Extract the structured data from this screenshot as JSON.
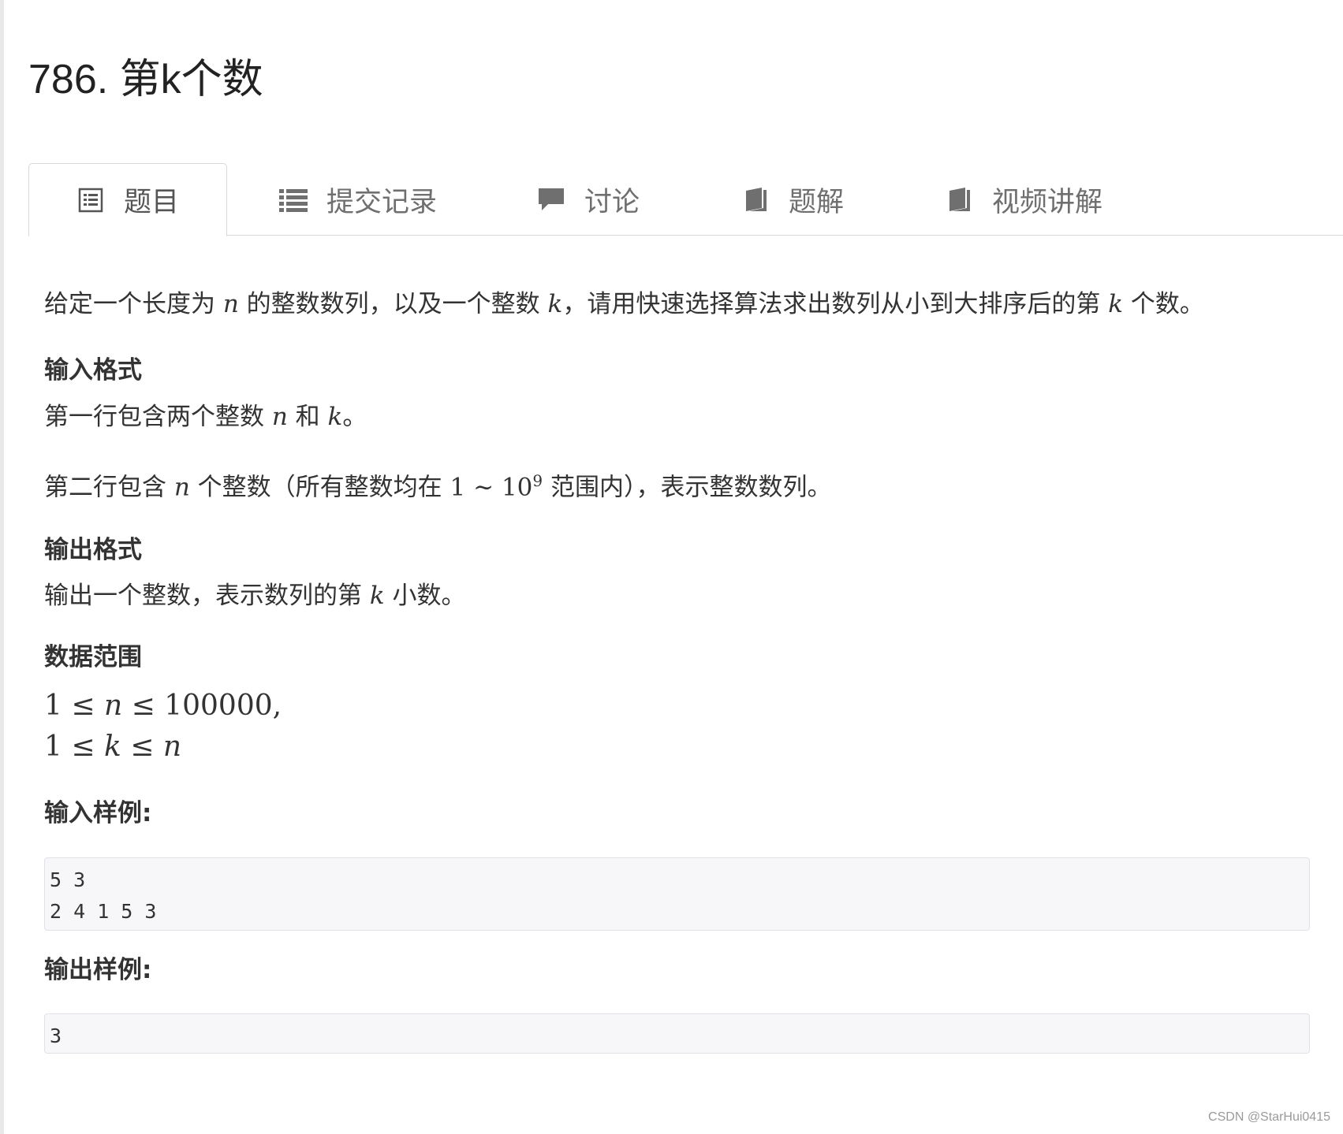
{
  "problem": {
    "title": "786. 第k个数"
  },
  "tabs": [
    {
      "label": "题目",
      "icon": "list-icon"
    },
    {
      "label": "提交记录",
      "icon": "bullet-list-icon"
    },
    {
      "label": "讨论",
      "icon": "comment-icon"
    },
    {
      "label": "题解",
      "icon": "book-icon"
    },
    {
      "label": "视频讲解",
      "icon": "book-icon"
    }
  ],
  "description": {
    "p1": [
      "给定一个长度为 ",
      "n",
      " 的整数数列，以及一个整数 ",
      "k",
      "，请用快速选择算法求出数列从小到大排序后的第 ",
      "k",
      " 个数。"
    ]
  },
  "input_format": {
    "heading": "输入格式",
    "line1": [
      "第一行包含两个整数 ",
      "n",
      " 和 ",
      "k",
      "。"
    ],
    "line2": [
      "第二行包含 ",
      "n",
      " 个整数（所有整数均在 ",
      "1 ∼ 10",
      "9",
      " 范围内），表示整数数列。"
    ]
  },
  "output_format": {
    "heading": "输出格式",
    "line1": [
      "输出一个整数，表示数列的第 ",
      "k",
      " 小数。"
    ]
  },
  "data_range": {
    "heading": "数据范围",
    "line1_a": "1 ≤ ",
    "line1_n": "n",
    "line1_b": " ≤ 100000,",
    "line2_a": "1 ≤ ",
    "line2_k": "k",
    "line2_b": " ≤ ",
    "line2_n": "n"
  },
  "sample_input": {
    "heading": "输入样例:",
    "code": "5 3\n2 4 1 5 3"
  },
  "sample_output": {
    "heading": "输出样例:",
    "code": "3"
  },
  "watermark": "CSDN @StarHui0415"
}
